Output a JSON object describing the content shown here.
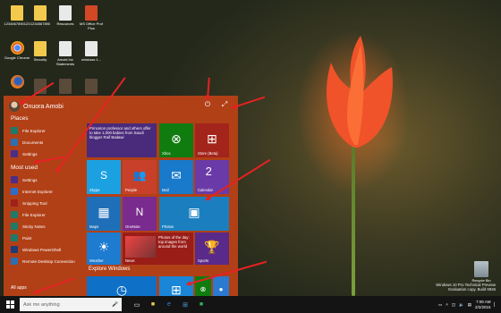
{
  "desktop": {
    "icons": [
      {
        "label": "1234567890123",
        "glyph": "folder"
      },
      {
        "label": "1234567890",
        "glyph": "folder"
      },
      {
        "label": "Resources",
        "glyph": "doc"
      },
      {
        "label": "MS Office Prof Plus",
        "glyph": "office"
      },
      {
        "label": "Google Chrome",
        "glyph": "chrome"
      },
      {
        "label": "Security",
        "glyph": "folder"
      },
      {
        "label": "Amobi Inc Statements",
        "glyph": "doc"
      },
      {
        "label": "windows 1...",
        "glyph": "doc"
      },
      {
        "label": "",
        "glyph": "firefox"
      },
      {
        "label": "",
        "glyph": "dark"
      },
      {
        "label": "",
        "glyph": "dark"
      },
      {
        "label": "",
        "glyph": "dark"
      }
    ],
    "recycle_bin": "Recycle Bin"
  },
  "start_menu": {
    "user_name": "Onuora Amobi",
    "power_icon": "power-icon",
    "expand_icon": "expand-icon",
    "places_heading": "Places",
    "places": [
      {
        "label": "File Explorer",
        "icon": "folder-icon",
        "color": "#1e7a6a"
      },
      {
        "label": "Documents",
        "icon": "documents-icon",
        "color": "#2d6fb3"
      },
      {
        "label": "Settings",
        "icon": "gear-icon",
        "color": "#4b2d8a"
      }
    ],
    "most_used_heading": "Most used",
    "most_used": [
      {
        "label": "Settings",
        "icon": "gear-icon",
        "color": "#4b2d8a"
      },
      {
        "label": "Internet Explorer",
        "icon": "internet-explorer-icon",
        "color": "#2a6fc9"
      },
      {
        "label": "Snipping Tool",
        "icon": "scissors-icon",
        "color": "#a0201c"
      },
      {
        "label": "File Explorer",
        "icon": "folder-icon",
        "color": "#1e7a6a"
      },
      {
        "label": "Sticky Notes",
        "icon": "sticky-note-icon",
        "color": "#1e7a6a"
      },
      {
        "label": "Paint",
        "icon": "paint-icon",
        "color": "#1e7a6a"
      },
      {
        "label": "Windows PowerShell",
        "icon": "powershell-icon",
        "color": "#1d3c78"
      },
      {
        "label": "Remote Desktop Connection",
        "icon": "remote-desktop-icon",
        "color": "#2d6fb3"
      }
    ],
    "all_apps": "All apps",
    "tiles": [
      {
        "id": "news-top",
        "text": "Princeton professor and others offer to take 1,000 babies from Saudi blogger Raif Badawi",
        "label": "",
        "glyph": "",
        "color": "#4a2a7a"
      },
      {
        "id": "xbox",
        "text": "",
        "label": "Xbox",
        "glyph": "xbox-icon",
        "color": "#107c10"
      },
      {
        "id": "store",
        "text": "",
        "label": "Store (Beta)",
        "glyph": "store-icon",
        "color": "#a3241b"
      },
      {
        "id": "skype",
        "text": "",
        "label": "Skype",
        "glyph": "skype-icon",
        "color": "#1ba1e2"
      },
      {
        "id": "people",
        "text": "",
        "label": "People",
        "glyph": "people-icon",
        "color": "#c8402a"
      },
      {
        "id": "mail",
        "text": "",
        "label": "Mail",
        "glyph": "mail-icon",
        "color": "#1979ca"
      },
      {
        "id": "calendar",
        "text": "2",
        "label": "Calendar",
        "glyph": "",
        "color": "#6a3aa8"
      },
      {
        "id": "maps",
        "text": "",
        "label": "Maps",
        "glyph": "maps-icon",
        "color": "#1f6fb8"
      },
      {
        "id": "onenote",
        "text": "",
        "label": "OneNote",
        "glyph": "onenote-icon",
        "color": "#7a2b8e"
      },
      {
        "id": "photos",
        "text": "",
        "label": "Photos",
        "glyph": "photos-icon",
        "color": "#1b7fbf"
      },
      {
        "id": "weather",
        "text": "",
        "label": "Weather",
        "glyph": "sun-icon",
        "color": "#1d7bd0"
      },
      {
        "id": "news",
        "text": "Photos of the day: top images from around the world",
        "label": "News",
        "glyph": "",
        "color": "#9a1d18"
      },
      {
        "id": "sports",
        "text": "",
        "label": "Sports",
        "glyph": "trophy-icon",
        "color": "#5a2a8a"
      }
    ],
    "explore_heading": "Explore Windows",
    "explore_tiles": [
      {
        "id": "explore-1",
        "color": "#0f70c8",
        "glyph": "clock-icon"
      },
      {
        "id": "explore-2",
        "color": "#1a86d8",
        "glyph": "windows-icon"
      },
      {
        "id": "explore-3",
        "color": "#107c10",
        "glyph": "xbox-icon"
      },
      {
        "id": "explore-4",
        "color": "#2a7ad0",
        "glyph": "people-icon"
      }
    ]
  },
  "taskbar": {
    "search_placeholder": "Ask me anything",
    "mic_icon": "microphone-icon",
    "time": "7:08 AM",
    "date": "2/2/2015"
  },
  "watermark": {
    "line1": "Windows 10 Pro Technical Preview",
    "line2": "Evaluation copy. Build 9926"
  },
  "colors": {
    "start_accent": "#b14017",
    "taskbar": "#141414",
    "annotation_arrows": "#e52222"
  }
}
